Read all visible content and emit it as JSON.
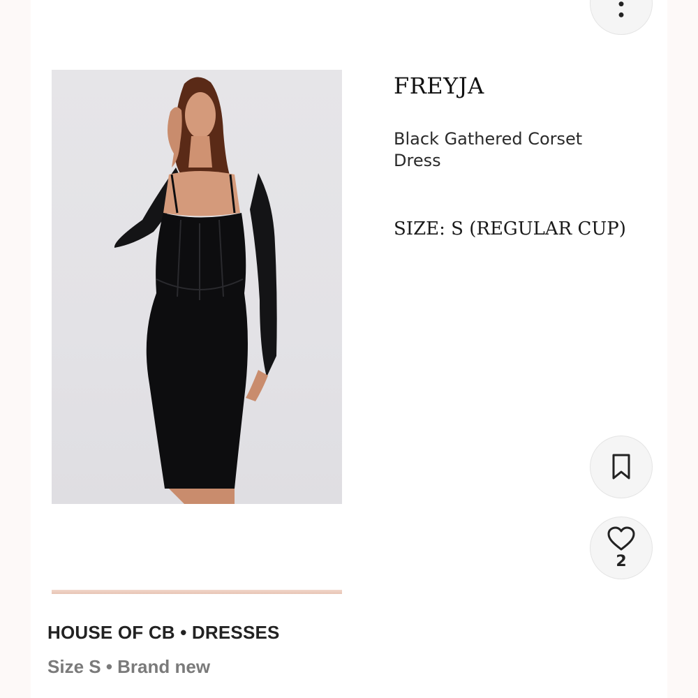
{
  "listing": {
    "brand_title": "FREYJA",
    "product_name": "Black Gathered Corset Dress",
    "size_label": "SIZE: S (REGULAR CUP)",
    "brand_category": "HOUSE OF CB • DRESSES",
    "size_condition": "Size S • Brand new"
  },
  "actions": {
    "more_icon": "more-vertical-icon",
    "save_icon": "bookmark-icon",
    "like_icon": "heart-icon",
    "like_count": "2"
  },
  "colors": {
    "text": "#111111",
    "muted": "#7a7a7a",
    "button_bg": "#f5f5f5",
    "photo_bg": "#e4e3e7",
    "dress": "#0d0d0f",
    "strip": "#ecccbc"
  }
}
